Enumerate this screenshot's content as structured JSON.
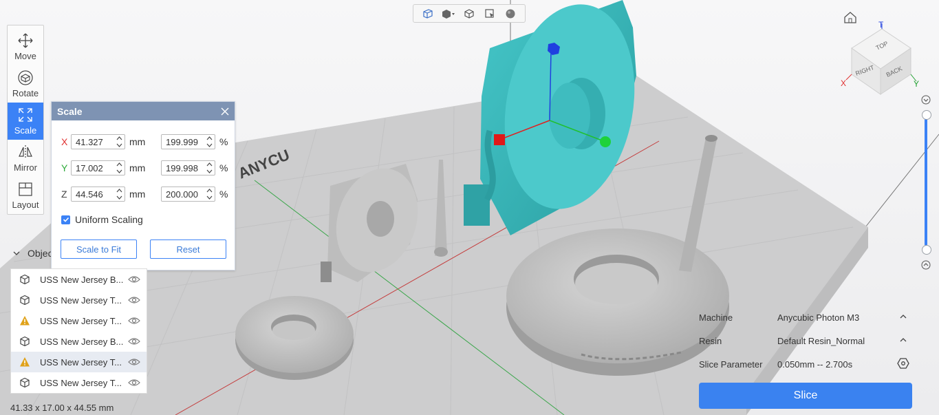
{
  "view_toolbar": {
    "icons": [
      "cube-outline-icon",
      "cube-solid-dropdown-icon",
      "cube-wireframe-icon",
      "select-cursor-icon",
      "sphere-icon"
    ]
  },
  "tools": [
    {
      "label": "Move",
      "icon": "move-arrows-icon"
    },
    {
      "label": "Rotate",
      "icon": "rotate-icon"
    },
    {
      "label": "Scale",
      "icon": "scale-icon",
      "active": true
    },
    {
      "label": "Mirror",
      "icon": "mirror-icon"
    },
    {
      "label": "Layout",
      "icon": "layout-icon"
    }
  ],
  "scale_dialog": {
    "title": "Scale",
    "rows": [
      {
        "axis": "X",
        "axis_color": "#e03030",
        "mm": "41.327",
        "unit_mm": "mm",
        "percent": "199.999",
        "unit_pct": "%"
      },
      {
        "axis": "Y",
        "axis_color": "#2eaa3a",
        "mm": "17.002",
        "unit_mm": "mm",
        "percent": "199.998",
        "unit_pct": "%"
      },
      {
        "axis": "Z",
        "axis_color": "#444444",
        "mm": "44.546",
        "unit_mm": "mm",
        "percent": "200.000",
        "unit_pct": "%"
      }
    ],
    "uniform_scaling_label": "Uniform Scaling",
    "uniform_scaling_checked": true,
    "scale_to_fit_label": "Scale to Fit",
    "reset_label": "Reset"
  },
  "objects": {
    "header": "Objec",
    "items": [
      {
        "name": "USS New Jersey B...",
        "icon": "cube-icon",
        "warning": false,
        "selected": false
      },
      {
        "name": "USS New Jersey T...",
        "icon": "cube-icon",
        "warning": false,
        "selected": false
      },
      {
        "name": "USS New Jersey T...",
        "icon": "warning-icon",
        "warning": true,
        "selected": false
      },
      {
        "name": "USS New Jersey B...",
        "icon": "cube-icon",
        "warning": false,
        "selected": false
      },
      {
        "name": "USS New Jersey T...",
        "icon": "warning-icon",
        "warning": true,
        "selected": true
      },
      {
        "name": "USS New Jersey T...",
        "icon": "cube-icon",
        "warning": false,
        "selected": false
      }
    ]
  },
  "dimensions": "41.33 x 17.00 x 44.55 mm",
  "printer_panel": {
    "machine_label": "Machine",
    "machine_value": "Anycubic Photon M3",
    "resin_label": "Resin",
    "resin_value": "Default Resin_Normal",
    "slice_param_label": "Slice Parameter",
    "slice_param_value": "0.050mm -- 2.700s",
    "slice_button": "Slice"
  },
  "view_cube": {
    "top_label": "TOP",
    "right_label": "RIGHT",
    "back_label": "BACK",
    "axis_t": "T",
    "axis_x": "X",
    "axis_y": "Y"
  },
  "plate_text": "ANYCU",
  "colors": {
    "accent": "#3b82f6",
    "model_selected": "#3fbcbf",
    "model": "#c4c4c4"
  }
}
